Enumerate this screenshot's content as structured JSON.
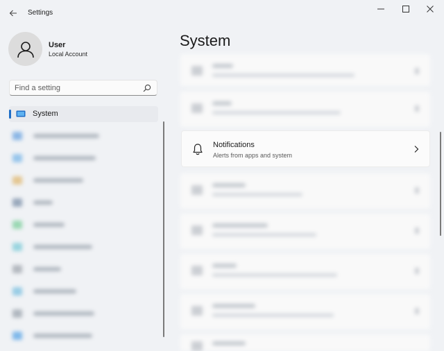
{
  "window": {
    "title": "Settings"
  },
  "account": {
    "name": "User",
    "type": "Local Account"
  },
  "search": {
    "placeholder": "Find a setting"
  },
  "nav": {
    "selected_label": "System",
    "accent": "#1f6ec7"
  },
  "main": {
    "page_title": "System",
    "notifications": {
      "title": "Notifications",
      "subtitle": "Alerts from apps and system"
    }
  }
}
